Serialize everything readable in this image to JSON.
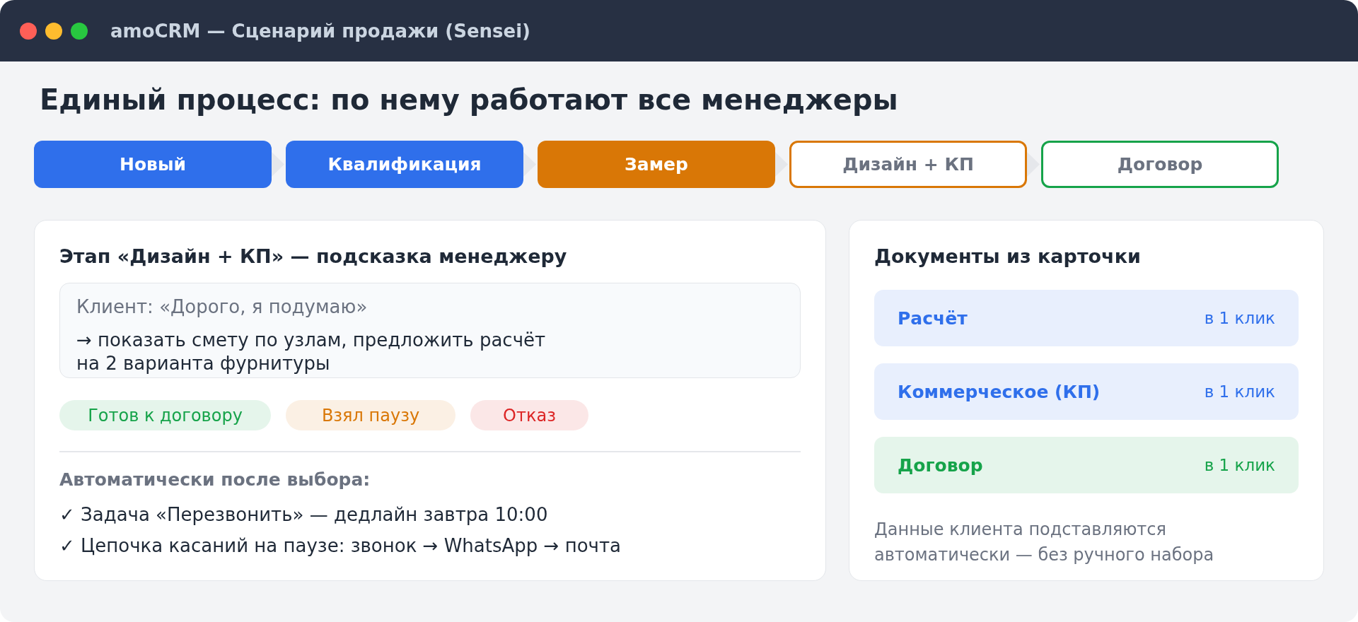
{
  "window": {
    "title": "amoCRM — Сценарий продажи (Sensei)"
  },
  "heading": "Единый процесс: по нему работают все менеджеры",
  "stages": [
    {
      "label": "Новый",
      "kind": "done"
    },
    {
      "label": "Квалификация",
      "kind": "done"
    },
    {
      "label": "Замер",
      "kind": "current"
    },
    {
      "label": "Дизайн + КП",
      "kind": "next"
    },
    {
      "label": "Договор",
      "kind": "target"
    }
  ],
  "hint_card": {
    "title": "Этап «Дизайн + КП» — подсказка менеджеру",
    "client_quote": "Клиент: «Дорого, я подумаю»",
    "advice": "→ показать смету по узлам, предложить расчёт\nна 2 варианта фурнитуры",
    "outcomes": [
      {
        "label": "Готов к договору",
        "color": "#16a34a"
      },
      {
        "label": "Взял паузу",
        "color": "#d97706"
      },
      {
        "label": "Отказ",
        "color": "#dc2626"
      }
    ],
    "automation_title": "Автоматически после выбора:",
    "automation_items": [
      "✓ Задача «Перезвонить» — дедлайн завтра 10:00",
      "✓ Цепочка касаний на паузе: звонок → WhatsApp → почта"
    ]
  },
  "documents_card": {
    "title": "Документы из карточки",
    "documents": [
      {
        "name": "Расчёт",
        "action": "в 1 клик",
        "color": "#2f6feb"
      },
      {
        "name": "Коммерческое (КП)",
        "action": "в 1 клик",
        "color": "#2f6feb"
      },
      {
        "name": "Договор",
        "action": "в 1 клик",
        "color": "#16a34a"
      }
    ],
    "note": "Данные клиента подставляются\nавтоматически — без ручного набора"
  }
}
